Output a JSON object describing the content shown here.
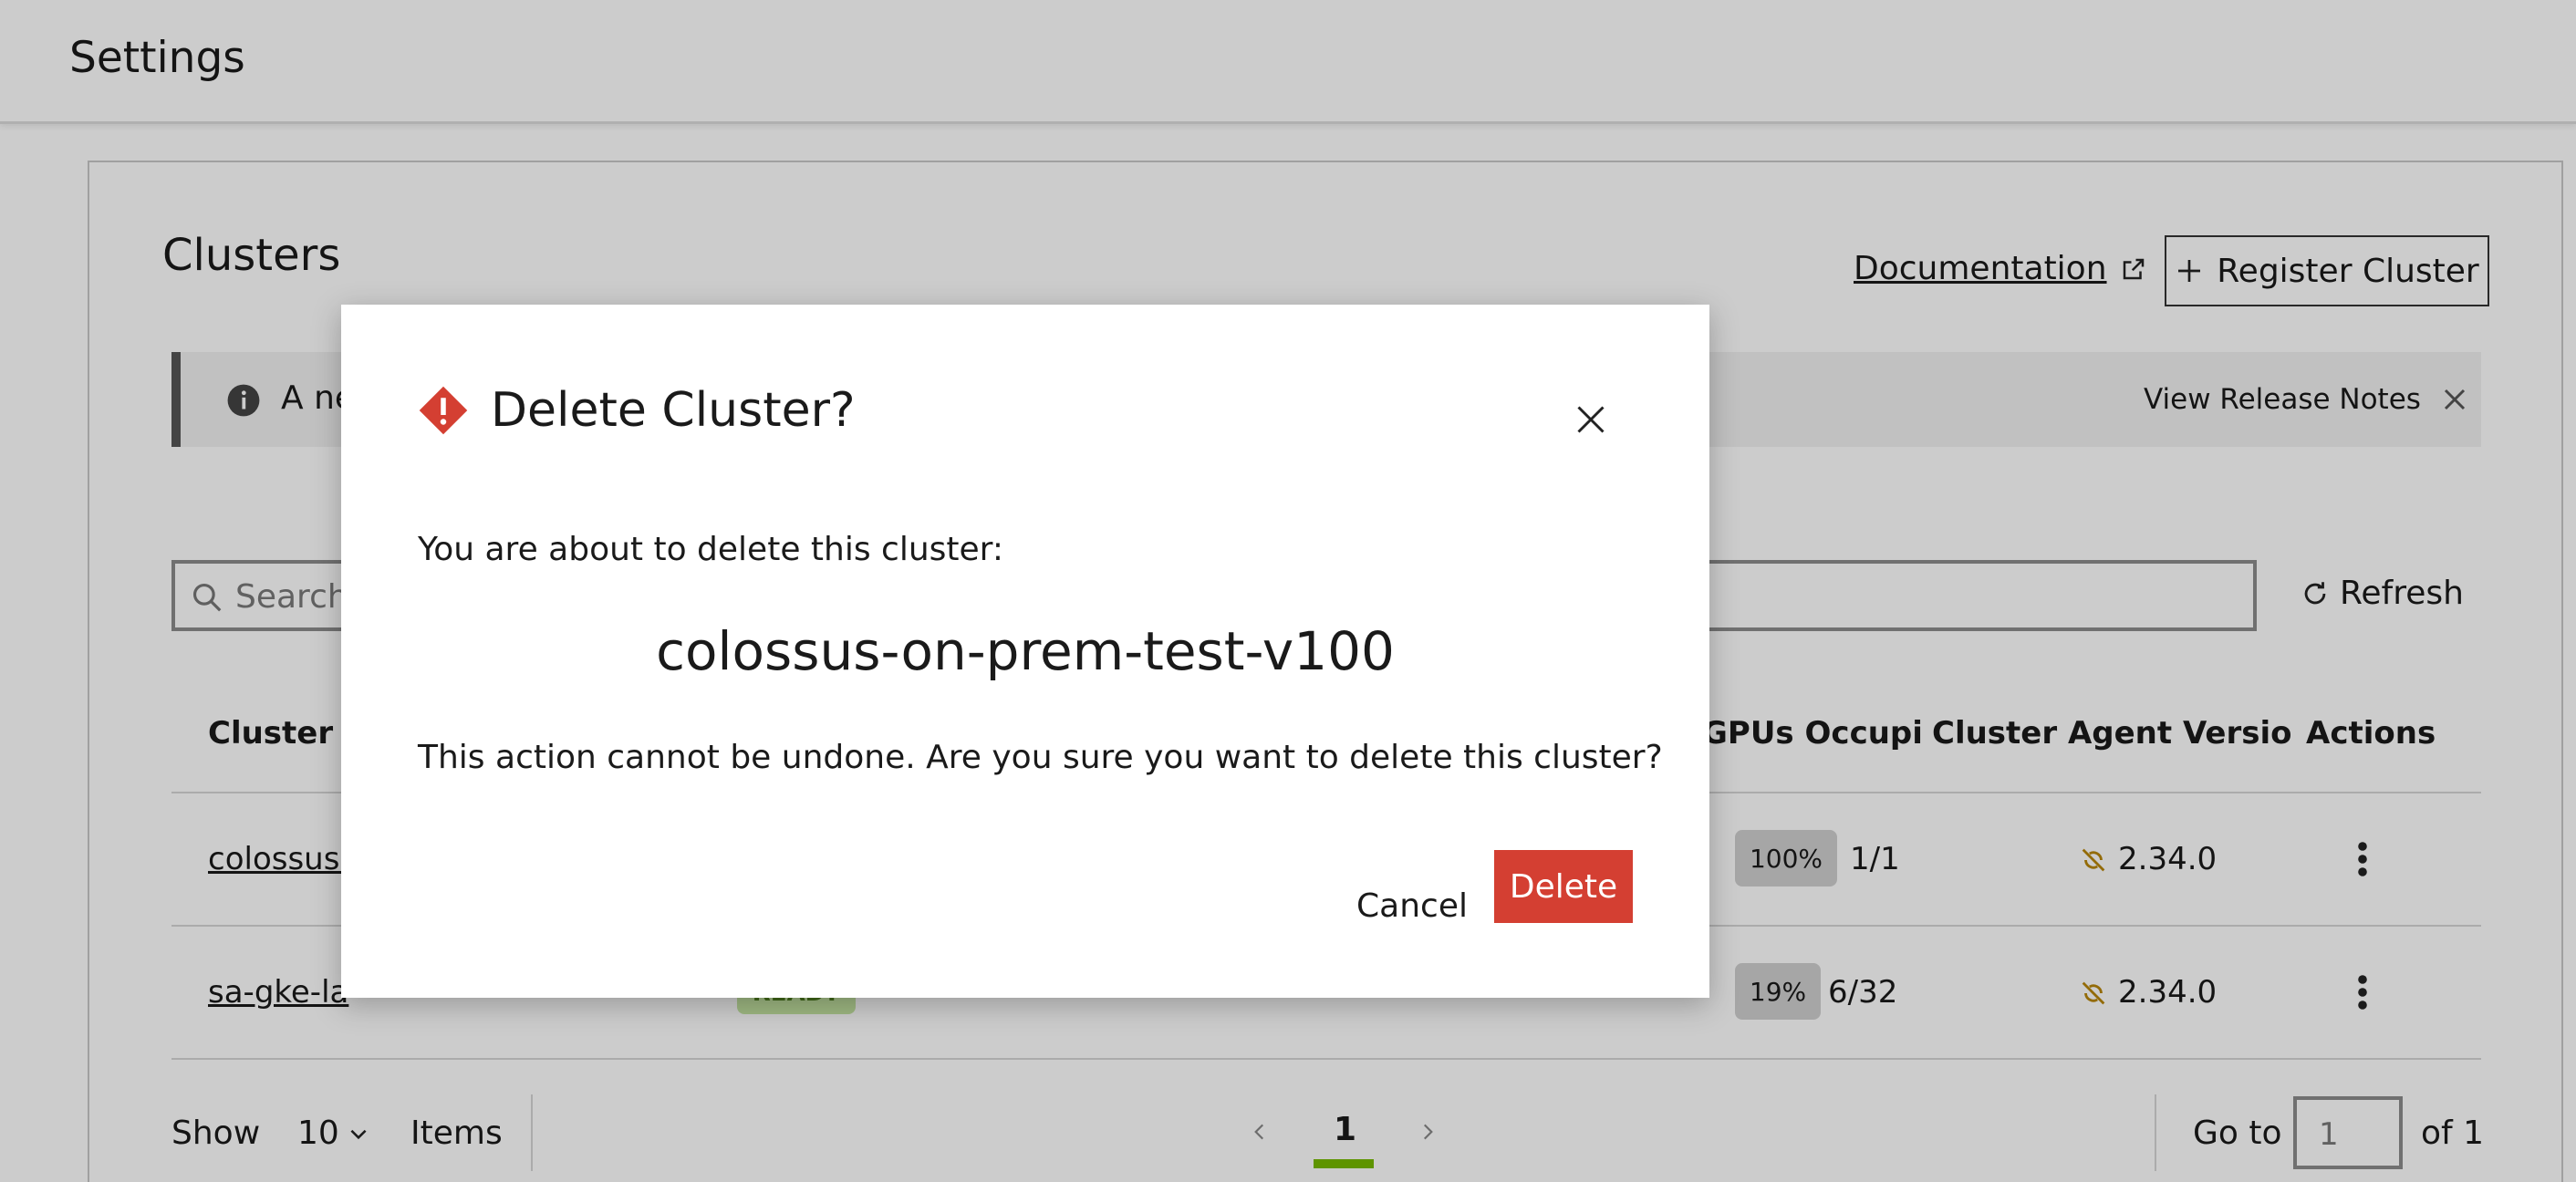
{
  "header": {
    "title": "Settings"
  },
  "page": {
    "heading": "Clusters",
    "documentation_label": "Documentation",
    "register_label": "Register Cluster"
  },
  "banner": {
    "message": "A ne",
    "notes_label": "View Release Notes"
  },
  "search": {
    "placeholder": "Search"
  },
  "refresh_label": "Refresh",
  "table": {
    "columns": [
      "Cluster N",
      "GPUs Occupi",
      "Cluster Agent Versio",
      "Actions"
    ],
    "rows": [
      {
        "name": "colossus-",
        "status": "",
        "created": "",
        "last": "",
        "gpu_pct": "100%",
        "gpu_count": "1/1",
        "version": "2.34.0"
      },
      {
        "name": "sa-gke-la",
        "status": "READY",
        "created": "",
        "last": "",
        "gpu_pct": "19%",
        "gpu_count": "6/32",
        "version": "2.34.0"
      }
    ]
  },
  "footer": {
    "show_label": "Show",
    "page_size": "10",
    "items_label": "Items",
    "current_page": "1",
    "goto_label": "Go to",
    "goto_value": "1",
    "of_label": "of 1"
  },
  "dialog": {
    "title": "Delete Cluster?",
    "lead": "You are about to delete this cluster:",
    "cluster_name": "colossus-on-prem-test-v100",
    "warning": "This action cannot be undone. Are you sure you want to delete this cluster?",
    "cancel_label": "Cancel",
    "delete_label": "Delete"
  },
  "colors": {
    "danger": "#d43f32",
    "accent": "#76b900",
    "ready_bg": "#c6e6a3"
  }
}
